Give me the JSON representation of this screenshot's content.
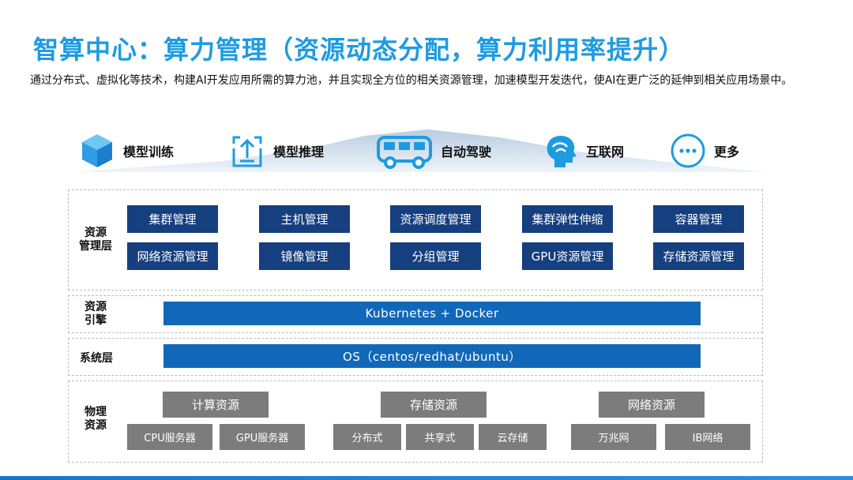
{
  "title": "智算中心：算力管理（资源动态分配，算力利用率提升）",
  "description": "通过分布式、虚拟化等技术，构建AI开发应用所需的算力池，并且实现全方位的相关资源管理，加速模型开发迭代，使AI在更广泛的延伸到相关应用场景中。",
  "apps": [
    {
      "label": "模型训练",
      "icon": "cube-icon"
    },
    {
      "label": "模型推理",
      "icon": "upload-tray-icon"
    },
    {
      "label": "自动驾驶",
      "icon": "bus-icon"
    },
    {
      "label": "互联网",
      "icon": "ai-head-icon"
    },
    {
      "label": "更多",
      "icon": "more-dots-icon"
    }
  ],
  "layers": {
    "resource_mgmt": {
      "label_line1": "资源",
      "label_line2": "管理层",
      "items": [
        "集群管理",
        "主机管理",
        "资源调度管理",
        "集群弹性伸缩",
        "容器管理",
        "网络资源管理",
        "镜像管理",
        "分组管理",
        "GPU资源管理",
        "存储资源管理"
      ]
    },
    "engine": {
      "label_line1": "资源",
      "label_line2": "引擎",
      "bar": "Kubernetes + Docker"
    },
    "system": {
      "label": "系统层",
      "bar": "OS（centos/redhat/ubuntu）"
    },
    "physical": {
      "label_line1": "物理",
      "label_line2": "资源",
      "groups": [
        {
          "name": "计算资源",
          "items": [
            "CPU服务器",
            "GPU服务器"
          ]
        },
        {
          "name": "存储资源",
          "items": [
            "分布式",
            "共享式",
            "云存储"
          ]
        },
        {
          "name": "网络资源",
          "items": [
            "万兆网",
            "IB网络"
          ]
        }
      ]
    }
  },
  "colors": {
    "title": "#1e9be0",
    "module_box": "#153f7f",
    "bar": "#1168b9",
    "physical_box": "#7c7c7c",
    "icon": "#1e9be0"
  }
}
